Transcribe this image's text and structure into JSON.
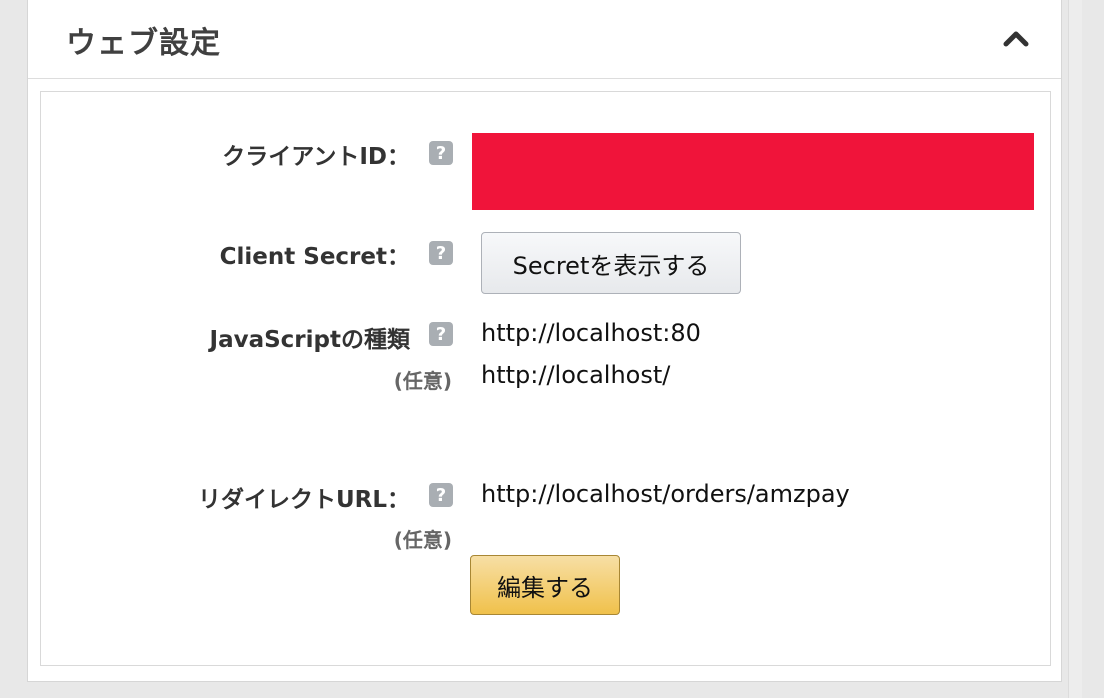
{
  "panel": {
    "title": "ウェブ設定",
    "collapse_icon": "chevron-up-icon"
  },
  "fields": {
    "client_id": {
      "label": "クライアントID：",
      "help_icon": "?",
      "value_redacted": true,
      "redaction_color": "#f0143a"
    },
    "client_secret": {
      "label": "Client Secret：",
      "help_icon": "?",
      "button_label": "Secretを表示する"
    },
    "javascript_origins": {
      "label": "JavaScriptの種類",
      "sublabel": "(任意)",
      "help_icon": "?",
      "values": [
        "http://localhost:80",
        "http://localhost/"
      ]
    },
    "redirect_url": {
      "label": "リダイレクトURL：",
      "sublabel": "(任意)",
      "help_icon": "?",
      "values": [
        "http://localhost/orders/amzpay"
      ]
    }
  },
  "actions": {
    "edit_label": "編集する"
  },
  "colors": {
    "primary_button": "#f0c14b",
    "secondary_button": "#e7e9ec",
    "help_icon": "#a9aeb3"
  }
}
